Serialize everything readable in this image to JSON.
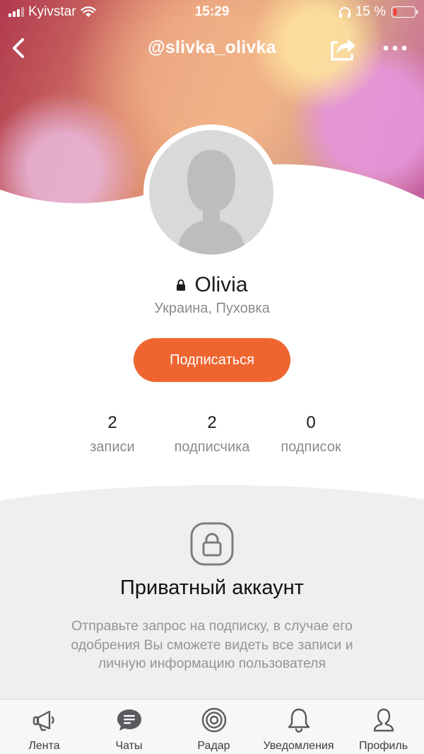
{
  "status_bar": {
    "carrier": "Kyivstar",
    "time": "15:29",
    "battery_percent": "15 %",
    "battery_level": 0.15
  },
  "nav": {
    "title": "@slivka_olivka",
    "back_icon": "chevron-left-icon",
    "share_icon": "share-icon",
    "more_icon": "more-icon"
  },
  "profile": {
    "name": "Olivia",
    "location": "Украина, Пуховка",
    "subscribe_label": "Подписаться",
    "accent_color": "#ee6530"
  },
  "stats": [
    {
      "value": "2",
      "label": "записи"
    },
    {
      "value": "2",
      "label": "подписчика"
    },
    {
      "value": "0",
      "label": "подписок"
    }
  ],
  "private_notice": {
    "title": "Приватный аккаунт",
    "text": "Отправьте запрос на подписку, в случае его одобрения Вы сможете видеть все записи и личную информацию пользователя"
  },
  "tabbar": [
    {
      "label": "Лента",
      "icon": "megaphone-icon"
    },
    {
      "label": "Чаты",
      "icon": "chat-bubble-icon"
    },
    {
      "label": "Радар",
      "icon": "radar-icon"
    },
    {
      "label": "Уведомления",
      "icon": "bell-icon"
    },
    {
      "label": "Профиль",
      "icon": "person-icon"
    }
  ]
}
